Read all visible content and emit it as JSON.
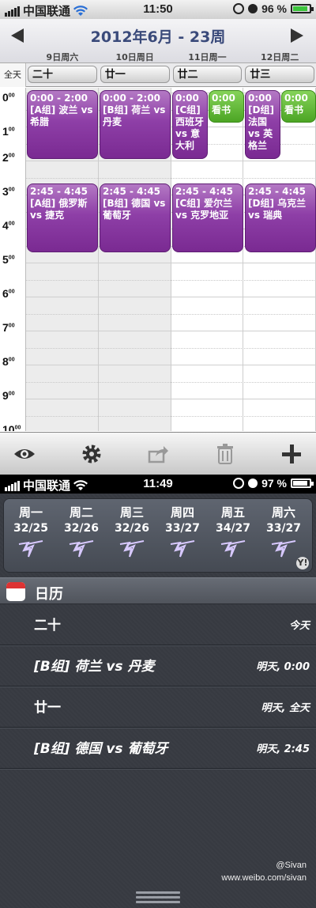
{
  "statusbar_top": {
    "carrier": "中国联通",
    "time": "11:50",
    "battery": "96 %"
  },
  "calendar": {
    "title": "2012年6月 - 23周",
    "days": [
      "9日周六",
      "10日周日",
      "11日周一",
      "12日周二"
    ],
    "allday_label": "全天",
    "allday_events": [
      "二十",
      "廿一",
      "廿二",
      "廿三"
    ],
    "hours": [
      "0",
      "1",
      "2",
      "3",
      "4",
      "5",
      "6",
      "7",
      "8",
      "9",
      "10"
    ],
    "hour_suffix": "00",
    "events": [
      {
        "time": "0:00 - 2:00",
        "title": "[A组] 波兰 vs 希腊"
      },
      {
        "time": "0:00 - 2:00",
        "title": "[B组] 荷兰 vs 丹麦"
      },
      {
        "time": "0:00",
        "title": "[C组] 西班牙 vs 意大利"
      },
      {
        "time": "0:00",
        "title": "看书"
      },
      {
        "time": "0:00",
        "title": "[D组] 法国 vs 英格兰"
      },
      {
        "time": "0:00",
        "title": "看书"
      },
      {
        "time": "2:45 - 4:45",
        "title": "[A组] 俄罗斯 vs 捷克"
      },
      {
        "time": "2:45 - 4:45",
        "title": "[B组] 德国 vs 葡萄牙"
      },
      {
        "time": "2:45 - 4:45",
        "title": "[C组] 爱尔兰 vs 克罗地亚"
      },
      {
        "time": "2:45 - 4:45",
        "title": "[D组] 乌克兰 vs 瑞典"
      }
    ],
    "colors": {
      "purple": "#8e3fa7",
      "green": "#4ca524"
    }
  },
  "toolbar": {
    "icons": [
      "eye-icon",
      "gear-icon",
      "share-icon",
      "trash-icon",
      "plus-icon"
    ]
  },
  "statusbar_bottom": {
    "carrier": "中国联通",
    "time": "11:49",
    "battery": "97 %"
  },
  "weather": {
    "days": [
      {
        "name": "周一",
        "temp": "32/25"
      },
      {
        "name": "周二",
        "temp": "32/26"
      },
      {
        "name": "周三",
        "temp": "32/26"
      },
      {
        "name": "周四",
        "temp": "33/27"
      },
      {
        "name": "周五",
        "temp": "34/27"
      },
      {
        "name": "周六",
        "temp": "33/27"
      }
    ],
    "provider_badge": "Y!"
  },
  "notification": {
    "section_title": "日历",
    "items": [
      {
        "title": "二十",
        "time": "今天"
      },
      {
        "title": "[B组] 荷兰 vs 丹麦",
        "time": "明天, 0:00"
      },
      {
        "title": "廿一",
        "time": "明天, 全天"
      },
      {
        "title": "[B组] 德国 vs 葡萄牙",
        "time": "明天, 2:45"
      }
    ]
  },
  "watermark": {
    "handle": "@Sivan",
    "url": "www.weibo.com/sivan"
  }
}
